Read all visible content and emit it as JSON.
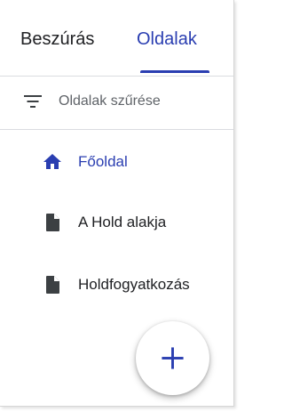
{
  "tabs": [
    {
      "label": "Beszúrás",
      "active": false
    },
    {
      "label": "Oldalak",
      "active": true
    }
  ],
  "filter": {
    "placeholder": "Oldalak szűrése",
    "icon": "filter-list-icon"
  },
  "pages": [
    {
      "label": "Főoldal",
      "icon": "home-icon",
      "active": true
    },
    {
      "label": "A Hold alakja",
      "icon": "document-icon",
      "active": false
    },
    {
      "label": "Holdfogyatkozás",
      "icon": "document-icon",
      "active": false
    }
  ],
  "fab": {
    "icon": "plus-icon"
  },
  "colors": {
    "accent": "#2a3eb1",
    "text": "#202124",
    "muted": "#5f6368",
    "icon": "#3c4043"
  }
}
